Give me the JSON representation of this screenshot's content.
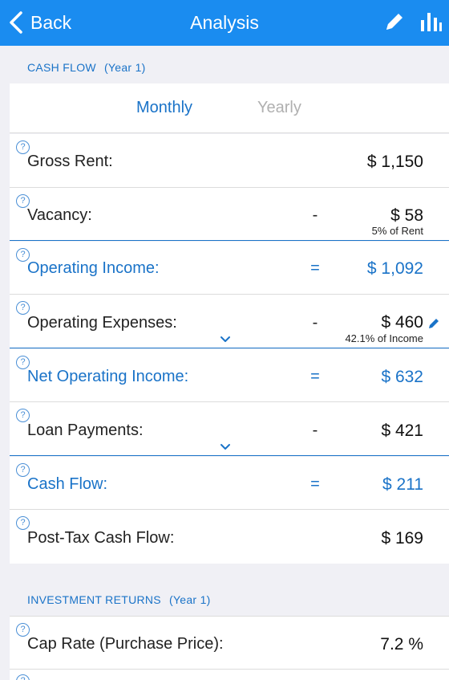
{
  "nav": {
    "back_label": "Back",
    "title": "Analysis",
    "edit_icon": "pencil-icon",
    "chart_icon": "bar-chart-icon",
    "bar_color": "#1a8cf0"
  },
  "cash_flow": {
    "header": "CASH FLOW",
    "year": "(Year 1)",
    "tabs": {
      "monthly": "Monthly",
      "yearly": "Yearly",
      "selected": "Monthly"
    },
    "rows": [
      {
        "label": "Gross Rent:",
        "op": "",
        "value": "$ 1,150",
        "sub": ""
      },
      {
        "label": "Vacancy:",
        "op": "-",
        "value": "$ 58",
        "sub": "5% of Rent"
      },
      {
        "label": "Operating Income:",
        "op": "=",
        "value": "$ 1,092",
        "sub": ""
      },
      {
        "label": "Operating Expenses:",
        "op": "-",
        "value": "$ 460",
        "sub": "42.1% of Income"
      },
      {
        "label": "Net Operating Income:",
        "op": "=",
        "value": "$ 632",
        "sub": ""
      },
      {
        "label": "Loan Payments:",
        "op": "-",
        "value": "$ 421",
        "sub": ""
      },
      {
        "label": "Cash Flow:",
        "op": "=",
        "value": "$ 211",
        "sub": ""
      },
      {
        "label": "Post-Tax Cash Flow:",
        "op": "",
        "value": "$ 169",
        "sub": ""
      }
    ]
  },
  "investment_returns": {
    "header": "INVESTMENT RETURNS",
    "year": "(Year 1)",
    "rows": [
      {
        "label": "Cap Rate (Purchase Price):",
        "value": "7.2 %"
      }
    ]
  },
  "help_glyph": "?",
  "accent_color": "#1a73c8"
}
